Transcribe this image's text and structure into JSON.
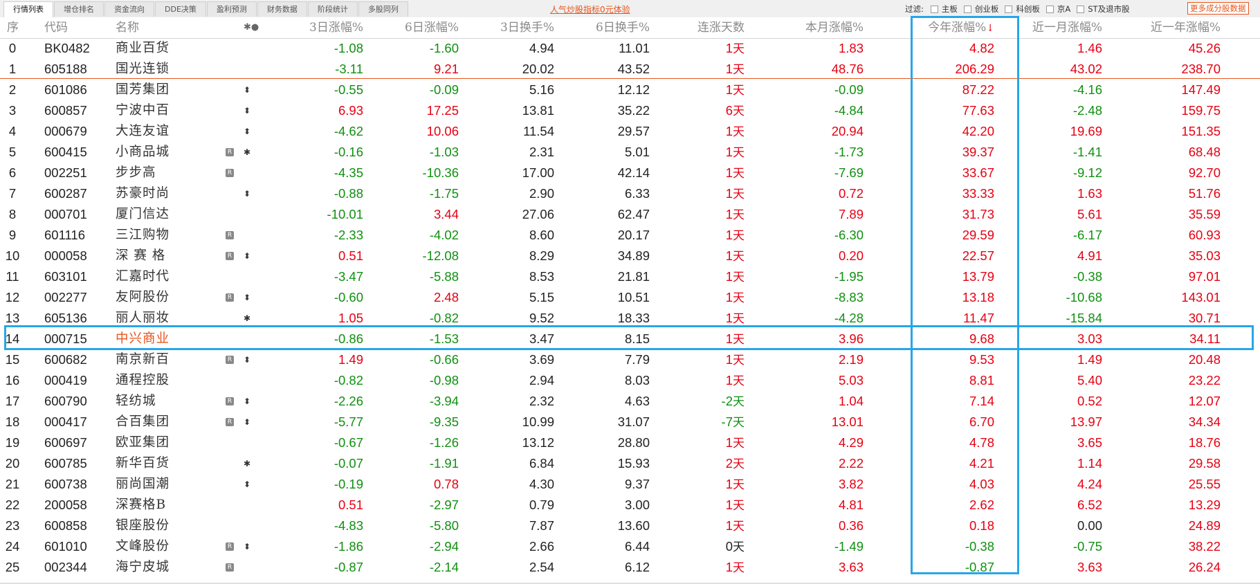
{
  "tabs": [
    {
      "label": "行情列表",
      "active": true
    },
    {
      "label": "增仓排名",
      "active": false
    },
    {
      "label": "资金流向",
      "active": false
    },
    {
      "label": "DDE决策",
      "active": false
    },
    {
      "label": "盈利预测",
      "active": false
    },
    {
      "label": "财务数据",
      "active": false
    },
    {
      "label": "阶段统计",
      "active": false
    },
    {
      "label": "多股同列",
      "active": false
    }
  ],
  "promo_link": "人气炒股指标0元体验",
  "filter": {
    "label": "过滤:",
    "options": [
      "主板",
      "创业板",
      "科创板",
      "京A",
      "ST及退市股"
    ],
    "more_button": "更多成分股数据"
  },
  "columns": {
    "index": "序",
    "code": "代码",
    "name": "名称",
    "marks": "✱●",
    "chg3d": "3日涨幅%",
    "chg6d": "6日涨幅%",
    "turn3d": "3日换手%",
    "turn6d": "6日换手%",
    "streak": "连涨天数",
    "month": "本月涨幅%",
    "ytd": "今年涨幅%",
    "ytd_sort_icon": "↓",
    "m1": "近一月涨幅%",
    "y1": "近一年涨幅%"
  },
  "colors": {
    "up": "#e60012",
    "down": "#109010",
    "highlight": "#27a6e8",
    "accent": "#e8541a"
  },
  "rows": [
    {
      "idx": "0",
      "code": "BK0482",
      "name": "商业百货",
      "r": false,
      "a": "",
      "c3": "-1.08",
      "c6": "-1.60",
      "t3": "4.94",
      "t6": "11.01",
      "days": "1",
      "mo": "1.83",
      "ytd": "4.82",
      "m1": "1.46",
      "y1": "45.26"
    },
    {
      "idx": "1",
      "code": "605188",
      "name": "国光连锁",
      "r": false,
      "a": "",
      "c3": "-3.11",
      "c6": "9.21",
      "t3": "20.02",
      "t6": "43.52",
      "days": "1",
      "mo": "48.76",
      "ytd": "206.29",
      "m1": "43.02",
      "y1": "238.70"
    },
    {
      "idx": "2",
      "code": "601086",
      "name": "国芳集团",
      "r": false,
      "a": "⬍",
      "c3": "-0.55",
      "c6": "-0.09",
      "t3": "5.16",
      "t6": "12.12",
      "days": "1",
      "mo": "-0.09",
      "ytd": "87.22",
      "m1": "-4.16",
      "y1": "147.49"
    },
    {
      "idx": "3",
      "code": "600857",
      "name": "宁波中百",
      "r": false,
      "a": "⬍",
      "c3": "6.93",
      "c6": "17.25",
      "t3": "13.81",
      "t6": "35.22",
      "days": "6",
      "mo": "-4.84",
      "ytd": "77.63",
      "m1": "-2.48",
      "y1": "159.75"
    },
    {
      "idx": "4",
      "code": "000679",
      "name": "大连友谊",
      "r": false,
      "a": "⬍",
      "c3": "-4.62",
      "c6": "10.06",
      "t3": "11.54",
      "t6": "29.57",
      "days": "1",
      "mo": "20.94",
      "ytd": "42.20",
      "m1": "19.69",
      "y1": "151.35"
    },
    {
      "idx": "5",
      "code": "600415",
      "name": "小商品城",
      "r": true,
      "a": "✱",
      "c3": "-0.16",
      "c6": "-1.03",
      "t3": "2.31",
      "t6": "5.01",
      "days": "1",
      "mo": "-1.73",
      "ytd": "39.37",
      "m1": "-1.41",
      "y1": "68.48"
    },
    {
      "idx": "6",
      "code": "002251",
      "name": "步步高",
      "r": true,
      "a": "",
      "c3": "-4.35",
      "c6": "-10.36",
      "t3": "17.00",
      "t6": "42.14",
      "days": "1",
      "mo": "-7.69",
      "ytd": "33.67",
      "m1": "-9.12",
      "y1": "92.70"
    },
    {
      "idx": "7",
      "code": "600287",
      "name": "苏豪时尚",
      "r": false,
      "a": "⬍",
      "c3": "-0.88",
      "c6": "-1.75",
      "t3": "2.90",
      "t6": "6.33",
      "days": "1",
      "mo": "0.72",
      "ytd": "33.33",
      "m1": "1.63",
      "y1": "51.76"
    },
    {
      "idx": "8",
      "code": "000701",
      "name": "厦门信达",
      "r": false,
      "a": "",
      "c3": "-10.01",
      "c6": "3.44",
      "t3": "27.06",
      "t6": "62.47",
      "days": "1",
      "mo": "7.89",
      "ytd": "31.73",
      "m1": "5.61",
      "y1": "35.59"
    },
    {
      "idx": "9",
      "code": "601116",
      "name": "三江购物",
      "r": true,
      "a": "",
      "c3": "-2.33",
      "c6": "-4.02",
      "t3": "8.60",
      "t6": "20.17",
      "days": "1",
      "mo": "-6.30",
      "ytd": "29.59",
      "m1": "-6.17",
      "y1": "60.93"
    },
    {
      "idx": "10",
      "code": "000058",
      "name": "深 赛 格",
      "r": true,
      "a": "⬍",
      "c3": "0.51",
      "c6": "-12.08",
      "t3": "8.29",
      "t6": "34.89",
      "days": "1",
      "mo": "0.20",
      "ytd": "22.57",
      "m1": "4.91",
      "y1": "35.03"
    },
    {
      "idx": "11",
      "code": "603101",
      "name": "汇嘉时代",
      "r": false,
      "a": "",
      "c3": "-3.47",
      "c6": "-5.88",
      "t3": "8.53",
      "t6": "21.81",
      "days": "1",
      "mo": "-1.95",
      "ytd": "13.79",
      "m1": "-0.38",
      "y1": "97.01"
    },
    {
      "idx": "12",
      "code": "002277",
      "name": "友阿股份",
      "r": true,
      "a": "⬍",
      "c3": "-0.60",
      "c6": "2.48",
      "t3": "5.15",
      "t6": "10.51",
      "days": "1",
      "mo": "-8.83",
      "ytd": "13.18",
      "m1": "-10.68",
      "y1": "143.01"
    },
    {
      "idx": "13",
      "code": "605136",
      "name": "丽人丽妆",
      "r": false,
      "a": "✱",
      "c3": "1.05",
      "c6": "-0.82",
      "t3": "9.52",
      "t6": "18.33",
      "days": "1",
      "mo": "-4.28",
      "ytd": "11.47",
      "m1": "-15.84",
      "y1": "30.71"
    },
    {
      "idx": "14",
      "code": "000715",
      "name": "中兴商业",
      "r": false,
      "a": "",
      "c3": "-0.86",
      "c6": "-1.53",
      "t3": "3.47",
      "t6": "8.15",
      "days": "1",
      "mo": "3.96",
      "ytd": "9.68",
      "m1": "3.03",
      "y1": "34.11",
      "selected": true
    },
    {
      "idx": "15",
      "code": "600682",
      "name": "南京新百",
      "r": true,
      "a": "⬍",
      "c3": "1.49",
      "c6": "-0.66",
      "t3": "3.69",
      "t6": "7.79",
      "days": "1",
      "mo": "2.19",
      "ytd": "9.53",
      "m1": "1.49",
      "y1": "20.48"
    },
    {
      "idx": "16",
      "code": "000419",
      "name": "通程控股",
      "r": false,
      "a": "",
      "c3": "-0.82",
      "c6": "-0.98",
      "t3": "2.94",
      "t6": "8.03",
      "days": "1",
      "mo": "5.03",
      "ytd": "8.81",
      "m1": "5.40",
      "y1": "23.22"
    },
    {
      "idx": "17",
      "code": "600790",
      "name": "轻纺城",
      "r": true,
      "a": "⬍",
      "c3": "-2.26",
      "c6": "-3.94",
      "t3": "2.32",
      "t6": "4.63",
      "days": "-2",
      "mo": "1.04",
      "ytd": "7.14",
      "m1": "0.52",
      "y1": "12.07"
    },
    {
      "idx": "18",
      "code": "000417",
      "name": "合百集团",
      "r": true,
      "a": "⬍",
      "c3": "-5.77",
      "c6": "-9.35",
      "t3": "10.99",
      "t6": "31.07",
      "days": "-7",
      "mo": "13.01",
      "ytd": "6.70",
      "m1": "13.97",
      "y1": "34.34"
    },
    {
      "idx": "19",
      "code": "600697",
      "name": "欧亚集团",
      "r": false,
      "a": "",
      "c3": "-0.67",
      "c6": "-1.26",
      "t3": "13.12",
      "t6": "28.80",
      "days": "1",
      "mo": "4.29",
      "ytd": "4.78",
      "m1": "3.65",
      "y1": "18.76"
    },
    {
      "idx": "20",
      "code": "600785",
      "name": "新华百货",
      "r": false,
      "a": "✱",
      "c3": "-0.07",
      "c6": "-1.91",
      "t3": "6.84",
      "t6": "15.93",
      "days": "2",
      "mo": "2.22",
      "ytd": "4.21",
      "m1": "1.14",
      "y1": "29.58"
    },
    {
      "idx": "21",
      "code": "600738",
      "name": "丽尚国潮",
      "r": false,
      "a": "⬍",
      "c3": "-0.19",
      "c6": "0.78",
      "t3": "4.30",
      "t6": "9.37",
      "days": "1",
      "mo": "3.82",
      "ytd": "4.03",
      "m1": "4.24",
      "y1": "25.55"
    },
    {
      "idx": "22",
      "code": "200058",
      "name": "深赛格B",
      "r": false,
      "a": "",
      "c3": "0.51",
      "c6": "-2.97",
      "t3": "0.79",
      "t6": "3.00",
      "days": "1",
      "mo": "4.81",
      "ytd": "2.62",
      "m1": "6.52",
      "y1": "13.29"
    },
    {
      "idx": "23",
      "code": "600858",
      "name": "银座股份",
      "r": false,
      "a": "",
      "c3": "-4.83",
      "c6": "-5.80",
      "t3": "7.87",
      "t6": "13.60",
      "days": "1",
      "mo": "0.36",
      "ytd": "0.18",
      "m1": "0.00",
      "y1": "24.89"
    },
    {
      "idx": "24",
      "code": "601010",
      "name": "文峰股份",
      "r": true,
      "a": "⬍",
      "c3": "-1.86",
      "c6": "-2.94",
      "t3": "2.66",
      "t6": "6.44",
      "days": "0",
      "mo": "-1.49",
      "ytd": "-0.38",
      "m1": "-0.75",
      "y1": "38.22"
    },
    {
      "idx": "25",
      "code": "002344",
      "name": "海宁皮城",
      "r": true,
      "a": "",
      "c3": "-0.87",
      "c6": "-2.14",
      "t3": "2.54",
      "t6": "6.12",
      "days": "1",
      "mo": "3.63",
      "ytd": "-0.87",
      "m1": "3.63",
      "y1": "26.24"
    }
  ],
  "day_unit": "天",
  "r_mark": "R"
}
